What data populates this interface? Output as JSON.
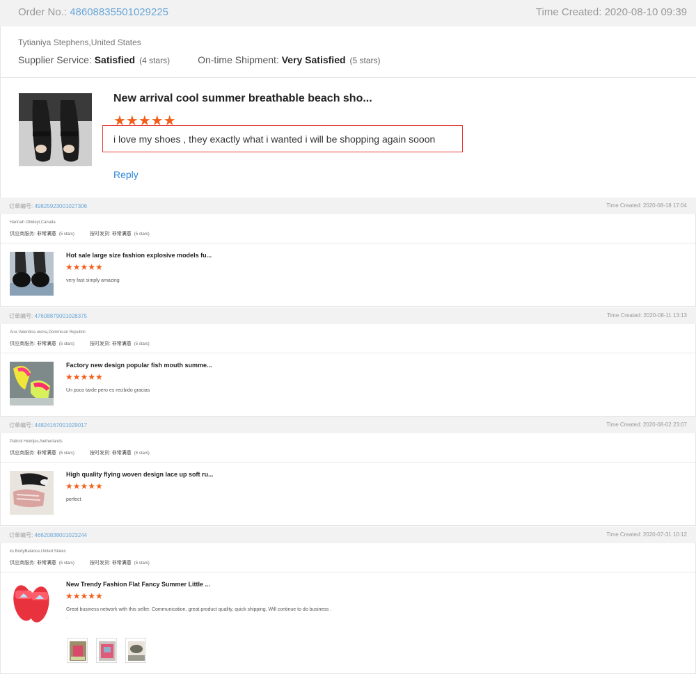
{
  "main_review": {
    "order_label": "Order No.: ",
    "order_number": "48608835501029225",
    "time_created": "Time Created: 2020-08-10 09:39",
    "buyer": "Tytianiya Stephens,United States",
    "supplier_label": "Supplier Service: ",
    "supplier_value": "Satisfied",
    "supplier_stars": "(4 stars)",
    "shipment_label": "On-time Shipment: ",
    "shipment_value": "Very Satisfied",
    "shipment_stars": "(5 stars)",
    "product_title": "New arrival cool summer breathable beach sho...",
    "stars": "★★★★★",
    "rating": 5,
    "comment": "i love my shoes , they exactly what i wanted i will be shopping again sooon",
    "reply_label": "Reply"
  },
  "reviews": [
    {
      "order_label": "订单编号: ",
      "order_number": "49825923001027306",
      "time_created": "Time Created: 2020-08-18 17:04",
      "buyer": "Hannah Obideyi,Canada",
      "supplier_label": "供应商服务: ",
      "supplier_value": "非常满意",
      "supplier_stars": "(5 stars)",
      "shipment_label": "按时发货: ",
      "shipment_value": "非常满意",
      "shipment_stars": "(5 stars)",
      "product_title": "Hot sale large size fashion explosive models fu...",
      "stars": "★★★★★",
      "rating": 5,
      "comment": "very fast simply amazing"
    },
    {
      "order_label": "订单编号: ",
      "order_number": "47608879001028375",
      "time_created": "Time Created: 2020-08-11 13:13",
      "buyer": "Ana Valentina urena,Dominican Republic",
      "supplier_label": "供应商服务: ",
      "supplier_value": "非常满意",
      "supplier_stars": "(5 stars)",
      "shipment_label": "按时发货: ",
      "shipment_value": "非常满意",
      "shipment_stars": "(5 stars)",
      "product_title": "Factory new design popular fish mouth summe...",
      "stars": "★★★★★",
      "rating": 5,
      "comment": "Un poco tarde pero es recibido gracias"
    },
    {
      "order_label": "订单编号: ",
      "order_number": "44824167001029017",
      "time_created": "Time Created: 2020-08-02 23:07",
      "buyer": "Patrick Heintjes,Netherlands",
      "supplier_label": "供应商服务: ",
      "supplier_value": "非常满意",
      "supplier_stars": "(5 stars)",
      "shipment_label": "按时发货: ",
      "shipment_value": "非常满意",
      "shipment_stars": "(5 stars)",
      "product_title": "High quality flying woven design lace up soft ru...",
      "stars": "★★★★★",
      "rating": 5,
      "comment": "perfect"
    },
    {
      "order_label": "订单编号: ",
      "order_number": "46620838001023244",
      "time_created": "Time Created: 2020-07-31 10:12",
      "buyer": "ks BodyBalance,United States",
      "supplier_label": "供应商服务: ",
      "supplier_value": "非常满意",
      "supplier_stars": "(5 stars)",
      "shipment_label": "按时发货: ",
      "shipment_value": "非常满意",
      "shipment_stars": "(5 stars)",
      "product_title": "New Trendy Fashion Flat Fancy Summer Little ...",
      "stars": "★★★★★",
      "rating": 5,
      "comment": "Great business network with this seller. Communication, great product quality, quick shipping. Will continue to do business .",
      "comment_extra": "."
    }
  ]
}
